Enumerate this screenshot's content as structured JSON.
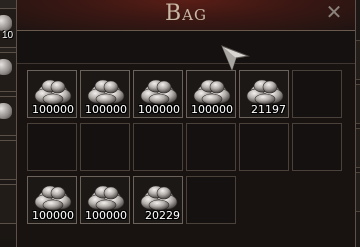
{
  "window": {
    "title": "Bag",
    "close_symbol": "✕"
  },
  "background": {
    "left_partial_count": "10"
  },
  "inventory": {
    "item_icon": "silver-ore-icon",
    "slots": [
      {
        "row": 0,
        "col": 0,
        "qty": "100000"
      },
      {
        "row": 0,
        "col": 1,
        "qty": "100000"
      },
      {
        "row": 0,
        "col": 2,
        "qty": "100000"
      },
      {
        "row": 0,
        "col": 3,
        "qty": "100000"
      },
      {
        "row": 0,
        "col": 4,
        "qty": "21197"
      },
      {
        "row": 0,
        "col": 5,
        "qty": null
      },
      {
        "row": 1,
        "col": 0,
        "qty": null
      },
      {
        "row": 1,
        "col": 1,
        "qty": null
      },
      {
        "row": 1,
        "col": 2,
        "qty": null
      },
      {
        "row": 1,
        "col": 3,
        "qty": null
      },
      {
        "row": 1,
        "col": 4,
        "qty": null
      },
      {
        "row": 1,
        "col": 5,
        "qty": null
      },
      {
        "row": 2,
        "col": 0,
        "qty": "100000"
      },
      {
        "row": 2,
        "col": 1,
        "qty": "100000"
      },
      {
        "row": 2,
        "col": 2,
        "qty": "20229"
      },
      {
        "row": 2,
        "col": 3,
        "qty": null
      }
    ]
  },
  "colors": {
    "header_red": "#5a1e16",
    "title_text": "#c9b8a4",
    "slot_border": "#4a413b",
    "qty_text": "#ffffff"
  },
  "cursor_icon": "pointer-arrow-icon"
}
